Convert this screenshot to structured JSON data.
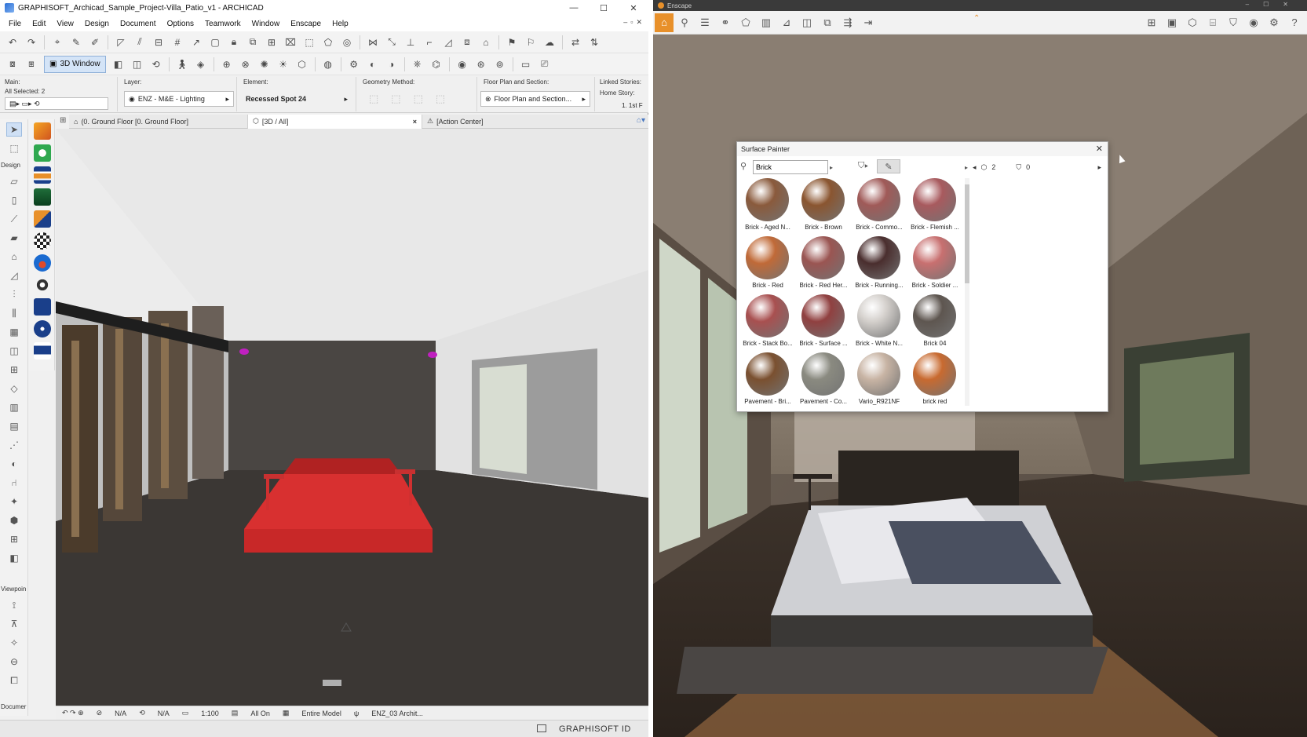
{
  "archicad": {
    "title": "GRAPHISOFT_Archicad_Sample_Project-Villa_Patio_v1 - ARCHICAD",
    "menu": [
      "File",
      "Edit",
      "View",
      "Design",
      "Document",
      "Options",
      "Teamwork",
      "Window",
      "Enscape",
      "Help"
    ],
    "toolbar": {
      "window_3d_label": "3D Window"
    },
    "infobox": {
      "main_label": "Main:",
      "selected": "All Selected: 2",
      "layer_label": "Layer:",
      "layer_value": "ENZ - M&E - Lighting",
      "element_label": "Element:",
      "element_value": "Recessed Spot 24",
      "geometry_label": "Geometry Method:",
      "floorplan_label": "Floor Plan and Section:",
      "floorplan_value": "Floor Plan and Section...",
      "linked_label": "Linked Stories:",
      "home_story_label": "Home Story:",
      "home_story_value": "1. 1st F"
    },
    "tabs": [
      {
        "label": "(0. Ground Floor [0. Ground Floor]"
      },
      {
        "label": "[3D / All]",
        "close": "×"
      },
      {
        "label": "[Action Center]"
      }
    ],
    "toolbox": {
      "design_label": "Design",
      "viewpoint_label": "Viewpoin",
      "document_label": "Documer"
    },
    "statusbar": {
      "na1": "N/A",
      "na2": "N/A",
      "scale": "1:100",
      "layers": "All On",
      "model": "Entire Model",
      "pen": "ENZ_03 Archit..."
    },
    "bottom": {
      "graphisoft_id": "GRAPHISOFT ID"
    }
  },
  "enscape": {
    "title": "Enscape",
    "surface_painter": {
      "title": "Surface Painter",
      "search_value": "Brick",
      "count_a": "2",
      "count_b": "0",
      "materials": [
        {
          "label": "Brick - Aged N...",
          "color": "#8a5a3c"
        },
        {
          "label": "Brick - Brown",
          "color": "#8a5530"
        },
        {
          "label": "Brick - Commo...",
          "color": "#a05a58"
        },
        {
          "label": "Brick - Flemish ...",
          "color": "#a85a5e"
        },
        {
          "label": "Brick - Red",
          "color": "#c06a38"
        },
        {
          "label": "Brick - Red Her...",
          "color": "#9a5552"
        },
        {
          "label": "Brick - Running...",
          "color": "#4a2e2e"
        },
        {
          "label": "Brick - Soldier ...",
          "color": "#c87070"
        },
        {
          "label": "Brick - Stack Bo...",
          "color": "#a85050"
        },
        {
          "label": "Brick - Surface ...",
          "color": "#904040"
        },
        {
          "label": "Brick - White N...",
          "color": "#d4d0cc"
        },
        {
          "label": "Brick 04",
          "color": "#5e5650"
        },
        {
          "label": "Pavement - Bri...",
          "color": "#7a5030"
        },
        {
          "label": "Pavement - Co...",
          "color": "#8a8a80"
        },
        {
          "label": "Vario_R921NF",
          "color": "#c8b4a4"
        },
        {
          "label": "brick red",
          "color": "#c86a30"
        }
      ]
    }
  }
}
